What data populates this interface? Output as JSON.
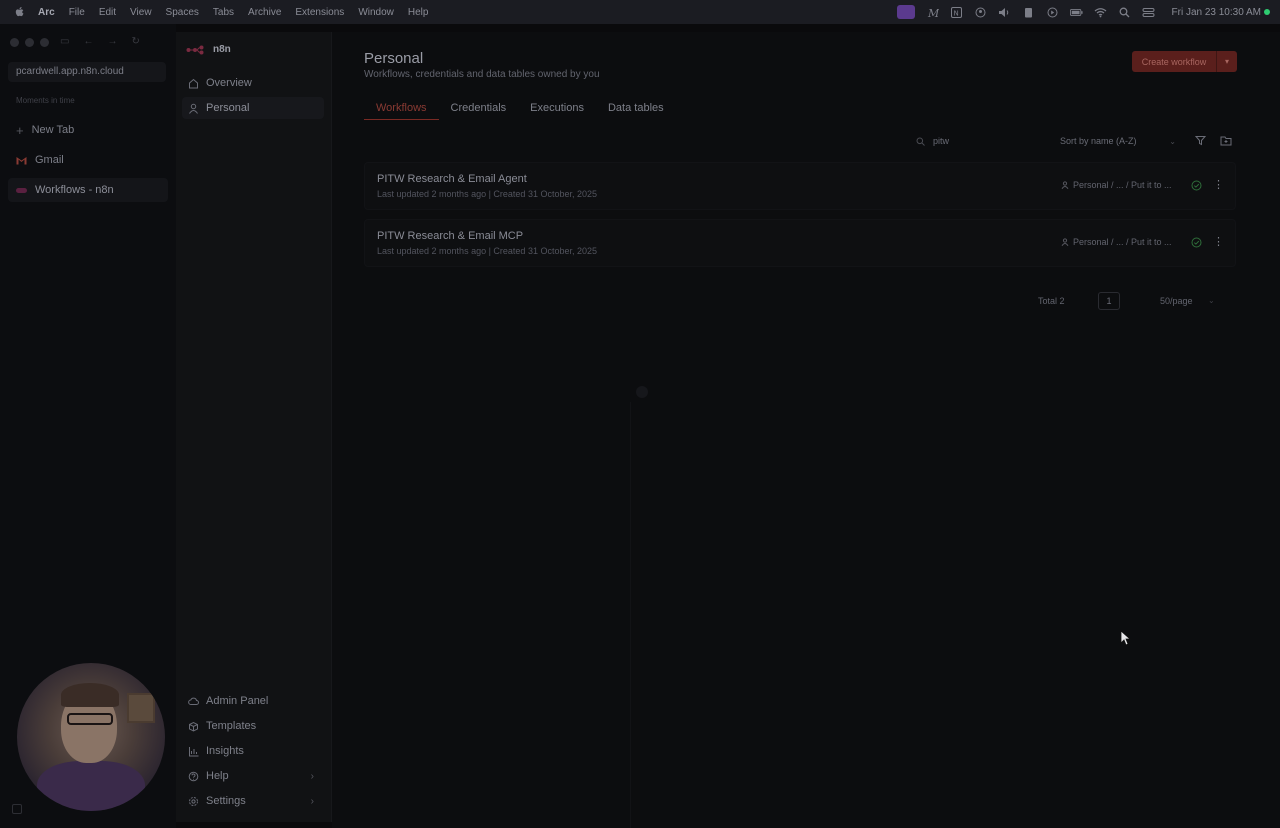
{
  "menubar": {
    "app": "Arc",
    "items": [
      "File",
      "Edit",
      "View",
      "Spaces",
      "Tabs",
      "Archive",
      "Extensions",
      "Window",
      "Help"
    ],
    "clock": "Fri Jan 23  10:30 AM"
  },
  "arc": {
    "url": "pcardwell.app.n8n.cloud",
    "small_label": "Moments in time",
    "tabs": [
      {
        "label": "New Tab"
      },
      {
        "label": "Gmail"
      },
      {
        "label": "Workflows - n8n"
      }
    ]
  },
  "n8n": {
    "brand": "n8n",
    "nav_top": [
      {
        "label": "Overview"
      },
      {
        "label": "Personal"
      }
    ],
    "nav_bottom": [
      {
        "label": "Admin Panel"
      },
      {
        "label": "Templates"
      },
      {
        "label": "Insights"
      },
      {
        "label": "Help"
      },
      {
        "label": "Settings"
      }
    ]
  },
  "main": {
    "title": "Personal",
    "subtitle": "Workflows, credentials and data tables owned by you",
    "create_button": "Create workflow",
    "tabs": [
      {
        "label": "Workflows"
      },
      {
        "label": "Credentials"
      },
      {
        "label": "Executions"
      },
      {
        "label": "Data tables"
      }
    ],
    "search_value": "pitw",
    "sort_value": "Sort by name (A-Z)",
    "workflows": [
      {
        "name": "PITW Research & Email Agent",
        "meta": "Last updated 2 months ago  |  Created 31 October, 2025",
        "owner": "Personal / ... / Put it to ..."
      },
      {
        "name": "PITW Research & Email MCP",
        "meta": "Last updated 2 months ago  |  Created 31 October, 2025",
        "owner": "Personal / ... / Put it to ..."
      }
    ],
    "pagination": {
      "total": "Total 2",
      "page": "1",
      "per_page": "50/page"
    }
  },
  "colors": {
    "accent": "#7a2a24",
    "active_status": "#2f6e3a"
  }
}
